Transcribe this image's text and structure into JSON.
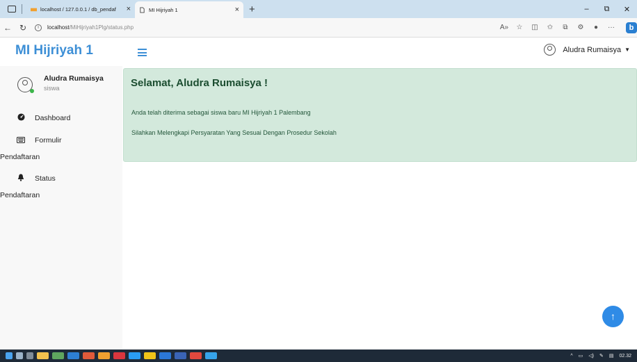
{
  "browser": {
    "tabs": [
      {
        "title": "localhost / 127.0.0.1 / db_pendaf",
        "active": false
      },
      {
        "title": "MI Hijriyah 1",
        "active": true
      }
    ],
    "url_host": "localhost",
    "url_path": "/MiHijriyah1Plg/status.php"
  },
  "app": {
    "brand": "MI Hijriyah 1",
    "header_user": "Aludra Rumaisya"
  },
  "sidebar": {
    "profile_name": "Aludra Rumaisya",
    "profile_role": "siswa",
    "items": [
      {
        "label_line1": "Dashboard",
        "label_line2": ""
      },
      {
        "label_line1": "Formulir",
        "label_line2": "Pendaftaran"
      },
      {
        "label_line1": "Status",
        "label_line2": "Pendaftaran"
      }
    ]
  },
  "welcome": {
    "heading": "Selamat, Aludra Rumaisya !",
    "line1": "Anda telah diterima sebagai siswa baru MI Hijriyah 1 Palembang",
    "line2": "Silahkan Melengkapi Persyaratan Yang Sesuai Dengan Prosedur Sekolah"
  },
  "taskbar": {
    "time": "02.32"
  },
  "colors": {
    "brand": "#3d8fd6",
    "welcome_bg": "#d3e9dc",
    "scroll_top_button": "#2f8be6"
  },
  "icons": [
    "window-icon",
    "back-icon",
    "refresh-icon",
    "info-icon",
    "menu-icon",
    "user-icon",
    "dashboard-icon",
    "keyboard-icon",
    "bell-icon",
    "arrow-up-icon"
  ]
}
